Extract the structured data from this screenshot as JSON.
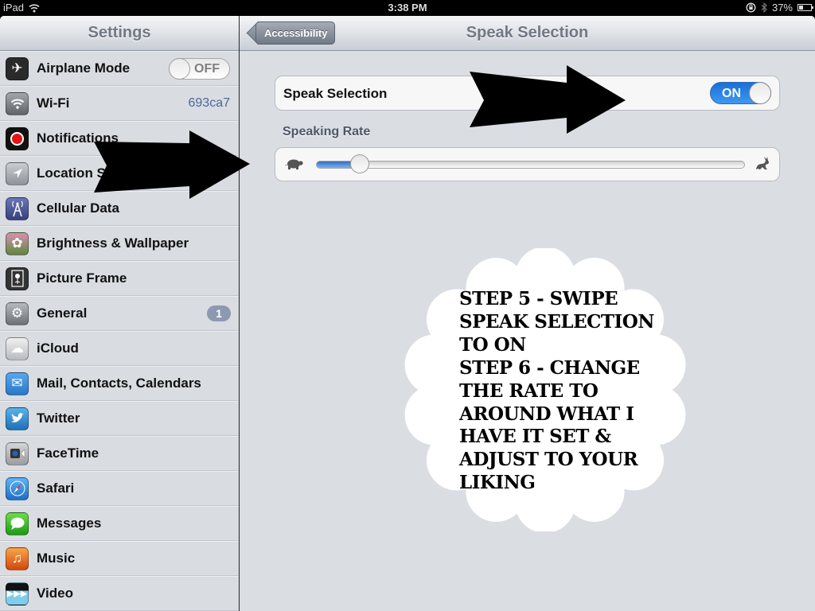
{
  "status_bar": {
    "device": "iPad",
    "time": "3:38 PM",
    "battery_percent": "37%",
    "battery_level": 0.37,
    "icons": [
      "wifi-icon",
      "rotation-lock-icon",
      "bluetooth-icon",
      "battery-icon"
    ]
  },
  "sidebar": {
    "title": "Settings",
    "items": [
      {
        "label": "Airplane Mode",
        "icon": "airplane-icon",
        "toggle": "OFF"
      },
      {
        "label": "Wi-Fi",
        "icon": "wifi-icon",
        "value": "693ca7"
      },
      {
        "label": "Notifications",
        "icon": "notifications-icon"
      },
      {
        "label": "Location Services",
        "icon": "location-icon"
      },
      {
        "label": "Cellular Data",
        "icon": "cellular-icon"
      },
      {
        "label": "Brightness & Wallpaper",
        "icon": "brightness-icon"
      },
      {
        "label": "Picture Frame",
        "icon": "picture-frame-icon"
      },
      {
        "label": "General",
        "icon": "gear-icon",
        "badge": "1"
      },
      {
        "label": "iCloud",
        "icon": "icloud-icon"
      },
      {
        "label": "Mail, Contacts, Calendars",
        "icon": "mail-icon"
      },
      {
        "label": "Twitter",
        "icon": "twitter-icon"
      },
      {
        "label": "FaceTime",
        "icon": "facetime-icon"
      },
      {
        "label": "Safari",
        "icon": "safari-icon"
      },
      {
        "label": "Messages",
        "icon": "messages-icon"
      },
      {
        "label": "Music",
        "icon": "music-icon"
      },
      {
        "label": "Video",
        "icon": "video-icon"
      }
    ]
  },
  "detail": {
    "back_label": "Accessibility",
    "title": "Speak Selection",
    "speak_selection": {
      "label": "Speak Selection",
      "toggle": "ON"
    },
    "speaking_rate": {
      "label": "Speaking Rate",
      "value": 0.1
    }
  },
  "annotation": {
    "lines": [
      "STEP 5 - SWIPE",
      "SPEAK SELECTION",
      "TO ON",
      "STEP 6 - CHANGE",
      "THE RATE TO",
      "AROUND WHAT I",
      "HAVE IT SET &",
      "ADJUST TO YOUR",
      "LIKING"
    ]
  }
}
